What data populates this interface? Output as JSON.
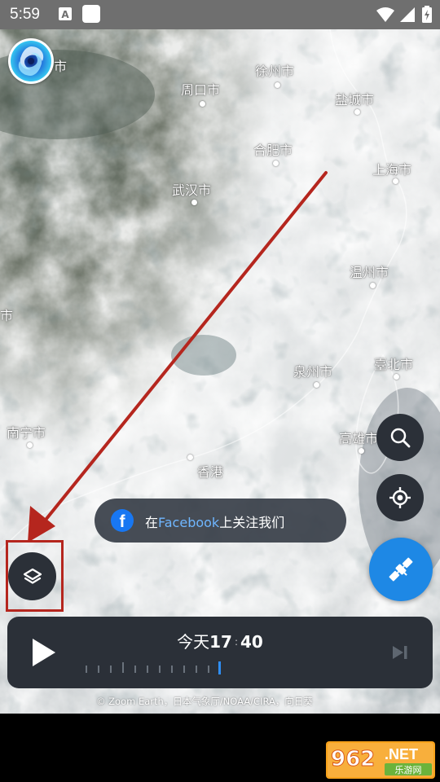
{
  "status_bar": {
    "time": "5:59",
    "left_icons": [
      "a-notification-icon",
      "square-notification-icon"
    ],
    "right_icons": [
      "wifi-icon",
      "cellular-signal-icon",
      "battery-icon"
    ]
  },
  "map": {
    "cities": [
      {
        "id": "tl-partial",
        "label": "市"
      },
      {
        "id": "xuzhou",
        "label": "徐州市"
      },
      {
        "id": "zhoukou",
        "label": "周口市"
      },
      {
        "id": "yancheng",
        "label": "盐城市"
      },
      {
        "id": "hefei",
        "label": "合肥市"
      },
      {
        "id": "shanghai",
        "label": "上海市"
      },
      {
        "id": "wuhan",
        "label": "武汉市"
      },
      {
        "id": "wenzhou",
        "label": "温州市"
      },
      {
        "id": "left-partial",
        "label": "市"
      },
      {
        "id": "quanzhou",
        "label": "泉州市"
      },
      {
        "id": "taibei",
        "label": "臺北市"
      },
      {
        "id": "nanning",
        "label": "南宁市"
      },
      {
        "id": "gaoxiong",
        "label": "高雄市"
      },
      {
        "id": "hongkong",
        "label": "香港"
      }
    ],
    "annotation_color": "#b5261e"
  },
  "facebook_banner": {
    "prefix": "在",
    "brand": "Facebook",
    "suffix": "上关注我们"
  },
  "player": {
    "day_label": "今天",
    "hour": "17",
    "separator": ":",
    "minute": "40"
  },
  "credit": "© Zoom Earth，日本气象厅/NOAA/CIRA，向日葵",
  "watermark": {
    "number": "962",
    "suffix": ".NET",
    "subtitle": "乐游网"
  },
  "colors": {
    "control_bg": "#2b3038",
    "accent_blue": "#1e88e5",
    "facebook_blue": "#1877f2",
    "timeline_cursor": "#2f8ef5"
  }
}
